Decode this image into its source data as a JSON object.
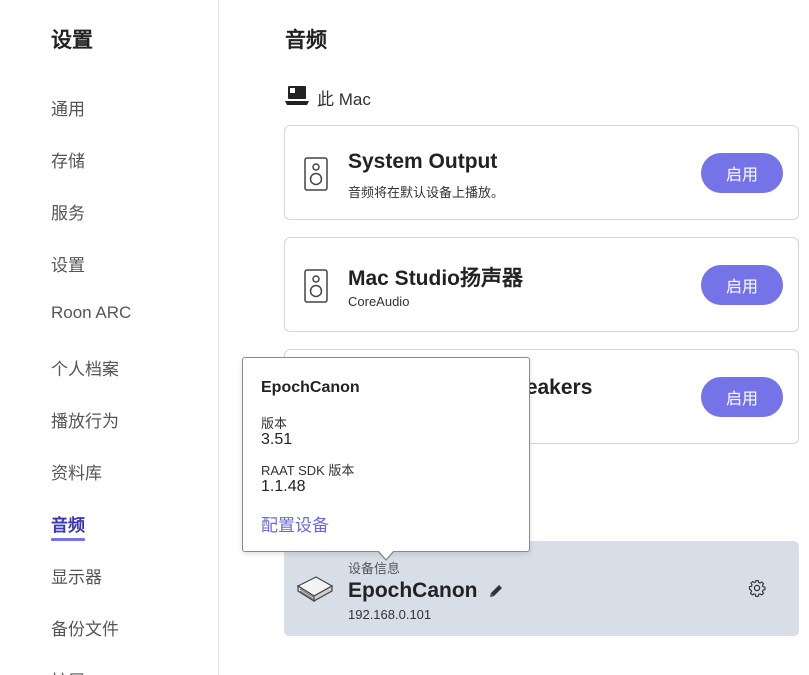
{
  "sidebar": {
    "title": "设置",
    "items": [
      {
        "label": "通用"
      },
      {
        "label": "存储"
      },
      {
        "label": "服务"
      },
      {
        "label": "设置"
      },
      {
        "label": "Roon ARC"
      },
      {
        "label": "个人档案"
      },
      {
        "label": "播放行为"
      },
      {
        "label": "资料库"
      },
      {
        "label": "音频"
      },
      {
        "label": "显示器"
      },
      {
        "label": "备份文件"
      },
      {
        "label": "扩展"
      }
    ],
    "active_item": "音频"
  },
  "main": {
    "title": "音频",
    "section_label": "此 Mac",
    "section_icon": "laptop-icon",
    "devices": [
      {
        "title": "System Output",
        "subtitle": "音频将在默认设备上播放。",
        "button": "启用",
        "icon": "speaker-icon"
      },
      {
        "title": "Mac Studio扬声器",
        "subtitle": "CoreAudio",
        "button": "启用",
        "icon": "speaker-icon"
      },
      {
        "title_visible": "peakers",
        "button": "启用"
      }
    ],
    "network_device": {
      "label": "设备信息",
      "name": "EpochCanon",
      "ip": "192.168.0.101",
      "icon": "device-icon"
    }
  },
  "popover": {
    "title": "EpochCanon",
    "version_label": "版本",
    "version_value": "3.51",
    "sdk_label": "RAAT SDK 版本",
    "sdk_value": "1.1.48",
    "link": "配置设备"
  },
  "colors": {
    "accent": "#7474e8",
    "active_text": "#3b3bb0",
    "device_card_bg": "#d8dee8",
    "link": "#6a6ad8"
  }
}
